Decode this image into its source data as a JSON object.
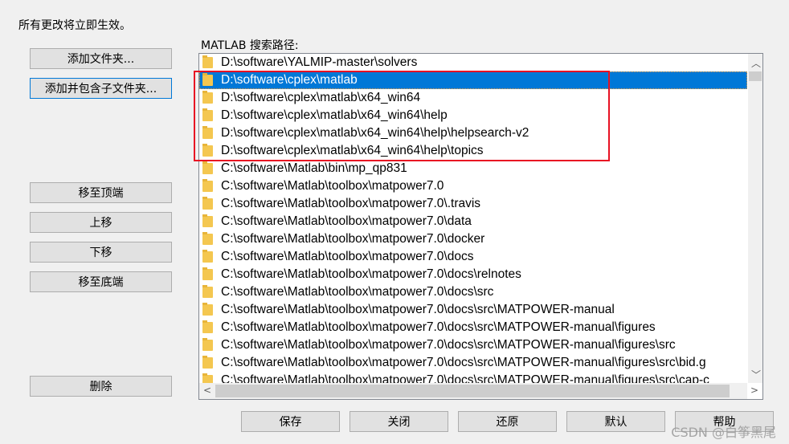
{
  "notice": "所有更改将立即生效。",
  "list_label": "MATLAB 搜索路径:",
  "left_buttons": {
    "add_folder": "添加文件夹...",
    "add_with_subfolders": "添加并包含子文件夹...",
    "move_top": "移至顶端",
    "move_up": "上移",
    "move_down": "下移",
    "move_bottom": "移至底端",
    "remove": "删除"
  },
  "paths": [
    "D:\\software\\YALMIP-master\\solvers",
    "D:\\software\\cplex\\matlab",
    "D:\\software\\cplex\\matlab\\x64_win64",
    "D:\\software\\cplex\\matlab\\x64_win64\\help",
    "D:\\software\\cplex\\matlab\\x64_win64\\help\\helpsearch-v2",
    "D:\\software\\cplex\\matlab\\x64_win64\\help\\topics",
    "C:\\software\\Matlab\\bin\\mp_qp831",
    "C:\\software\\Matlab\\toolbox\\matpower7.0",
    "C:\\software\\Matlab\\toolbox\\matpower7.0\\.travis",
    "C:\\software\\Matlab\\toolbox\\matpower7.0\\data",
    "C:\\software\\Matlab\\toolbox\\matpower7.0\\docker",
    "C:\\software\\Matlab\\toolbox\\matpower7.0\\docs",
    "C:\\software\\Matlab\\toolbox\\matpower7.0\\docs\\relnotes",
    "C:\\software\\Matlab\\toolbox\\matpower7.0\\docs\\src",
    "C:\\software\\Matlab\\toolbox\\matpower7.0\\docs\\src\\MATPOWER-manual",
    "C:\\software\\Matlab\\toolbox\\matpower7.0\\docs\\src\\MATPOWER-manual\\figures",
    "C:\\software\\Matlab\\toolbox\\matpower7.0\\docs\\src\\MATPOWER-manual\\figures\\src",
    "C:\\software\\Matlab\\toolbox\\matpower7.0\\docs\\src\\MATPOWER-manual\\figures\\src\\bid.g",
    "C:\\software\\Matlab\\toolbox\\matpower7.0\\docs\\src\\MATPOWER-manual\\figures\\src\\cap-c"
  ],
  "selected_index": 1,
  "bottom_buttons": {
    "save": "保存",
    "close": "关闭",
    "revert": "还原",
    "default": "默认",
    "help": "帮助"
  },
  "watermark": "CSDN @白筝黑尾",
  "colors": {
    "selection": "#0078d7",
    "highlight_box": "#e81123"
  }
}
